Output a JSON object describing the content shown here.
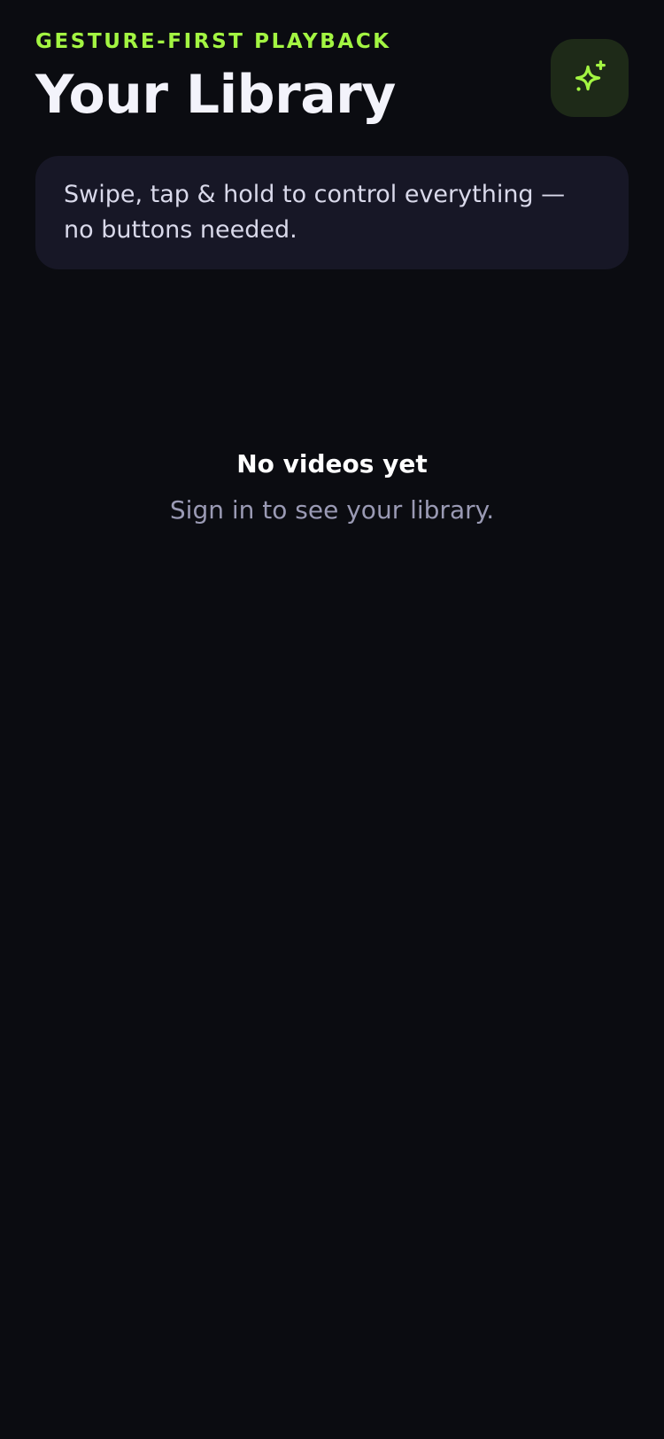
{
  "header": {
    "eyebrow": "GESTURE-FIRST PLAYBACK",
    "title": "Your Library",
    "action_icon": "sparkles-icon"
  },
  "hint": {
    "text": "Swipe, tap & hold to control everything — no buttons needed."
  },
  "empty_state": {
    "title": "No videos yet",
    "subtitle": "Sign in to see your library."
  },
  "colors": {
    "background": "#0b0c11",
    "accent": "#a3f542",
    "card": "#171726",
    "icon_button_bg": "#1e2a18",
    "muted_text": "#9a9ab4"
  }
}
